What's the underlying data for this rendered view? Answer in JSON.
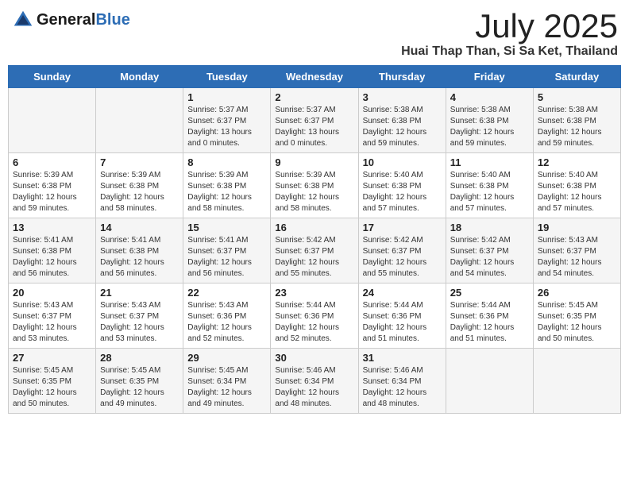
{
  "header": {
    "logo_general": "General",
    "logo_blue": "Blue",
    "month_title": "July 2025",
    "location": "Huai Thap Than, Si Sa Ket, Thailand"
  },
  "days_of_week": [
    "Sunday",
    "Monday",
    "Tuesday",
    "Wednesday",
    "Thursday",
    "Friday",
    "Saturday"
  ],
  "weeks": [
    [
      {
        "day": "",
        "info": ""
      },
      {
        "day": "",
        "info": ""
      },
      {
        "day": "1",
        "info": "Sunrise: 5:37 AM\nSunset: 6:37 PM\nDaylight: 13 hours and 0 minutes."
      },
      {
        "day": "2",
        "info": "Sunrise: 5:37 AM\nSunset: 6:37 PM\nDaylight: 13 hours and 0 minutes."
      },
      {
        "day": "3",
        "info": "Sunrise: 5:38 AM\nSunset: 6:38 PM\nDaylight: 12 hours and 59 minutes."
      },
      {
        "day": "4",
        "info": "Sunrise: 5:38 AM\nSunset: 6:38 PM\nDaylight: 12 hours and 59 minutes."
      },
      {
        "day": "5",
        "info": "Sunrise: 5:38 AM\nSunset: 6:38 PM\nDaylight: 12 hours and 59 minutes."
      }
    ],
    [
      {
        "day": "6",
        "info": "Sunrise: 5:39 AM\nSunset: 6:38 PM\nDaylight: 12 hours and 59 minutes."
      },
      {
        "day": "7",
        "info": "Sunrise: 5:39 AM\nSunset: 6:38 PM\nDaylight: 12 hours and 58 minutes."
      },
      {
        "day": "8",
        "info": "Sunrise: 5:39 AM\nSunset: 6:38 PM\nDaylight: 12 hours and 58 minutes."
      },
      {
        "day": "9",
        "info": "Sunrise: 5:39 AM\nSunset: 6:38 PM\nDaylight: 12 hours and 58 minutes."
      },
      {
        "day": "10",
        "info": "Sunrise: 5:40 AM\nSunset: 6:38 PM\nDaylight: 12 hours and 57 minutes."
      },
      {
        "day": "11",
        "info": "Sunrise: 5:40 AM\nSunset: 6:38 PM\nDaylight: 12 hours and 57 minutes."
      },
      {
        "day": "12",
        "info": "Sunrise: 5:40 AM\nSunset: 6:38 PM\nDaylight: 12 hours and 57 minutes."
      }
    ],
    [
      {
        "day": "13",
        "info": "Sunrise: 5:41 AM\nSunset: 6:38 PM\nDaylight: 12 hours and 56 minutes."
      },
      {
        "day": "14",
        "info": "Sunrise: 5:41 AM\nSunset: 6:38 PM\nDaylight: 12 hours and 56 minutes."
      },
      {
        "day": "15",
        "info": "Sunrise: 5:41 AM\nSunset: 6:37 PM\nDaylight: 12 hours and 56 minutes."
      },
      {
        "day": "16",
        "info": "Sunrise: 5:42 AM\nSunset: 6:37 PM\nDaylight: 12 hours and 55 minutes."
      },
      {
        "day": "17",
        "info": "Sunrise: 5:42 AM\nSunset: 6:37 PM\nDaylight: 12 hours and 55 minutes."
      },
      {
        "day": "18",
        "info": "Sunrise: 5:42 AM\nSunset: 6:37 PM\nDaylight: 12 hours and 54 minutes."
      },
      {
        "day": "19",
        "info": "Sunrise: 5:43 AM\nSunset: 6:37 PM\nDaylight: 12 hours and 54 minutes."
      }
    ],
    [
      {
        "day": "20",
        "info": "Sunrise: 5:43 AM\nSunset: 6:37 PM\nDaylight: 12 hours and 53 minutes."
      },
      {
        "day": "21",
        "info": "Sunrise: 5:43 AM\nSunset: 6:37 PM\nDaylight: 12 hours and 53 minutes."
      },
      {
        "day": "22",
        "info": "Sunrise: 5:43 AM\nSunset: 6:36 PM\nDaylight: 12 hours and 52 minutes."
      },
      {
        "day": "23",
        "info": "Sunrise: 5:44 AM\nSunset: 6:36 PM\nDaylight: 12 hours and 52 minutes."
      },
      {
        "day": "24",
        "info": "Sunrise: 5:44 AM\nSunset: 6:36 PM\nDaylight: 12 hours and 51 minutes."
      },
      {
        "day": "25",
        "info": "Sunrise: 5:44 AM\nSunset: 6:36 PM\nDaylight: 12 hours and 51 minutes."
      },
      {
        "day": "26",
        "info": "Sunrise: 5:45 AM\nSunset: 6:35 PM\nDaylight: 12 hours and 50 minutes."
      }
    ],
    [
      {
        "day": "27",
        "info": "Sunrise: 5:45 AM\nSunset: 6:35 PM\nDaylight: 12 hours and 50 minutes."
      },
      {
        "day": "28",
        "info": "Sunrise: 5:45 AM\nSunset: 6:35 PM\nDaylight: 12 hours and 49 minutes."
      },
      {
        "day": "29",
        "info": "Sunrise: 5:45 AM\nSunset: 6:34 PM\nDaylight: 12 hours and 49 minutes."
      },
      {
        "day": "30",
        "info": "Sunrise: 5:46 AM\nSunset: 6:34 PM\nDaylight: 12 hours and 48 minutes."
      },
      {
        "day": "31",
        "info": "Sunrise: 5:46 AM\nSunset: 6:34 PM\nDaylight: 12 hours and 48 minutes."
      },
      {
        "day": "",
        "info": ""
      },
      {
        "day": "",
        "info": ""
      }
    ]
  ]
}
